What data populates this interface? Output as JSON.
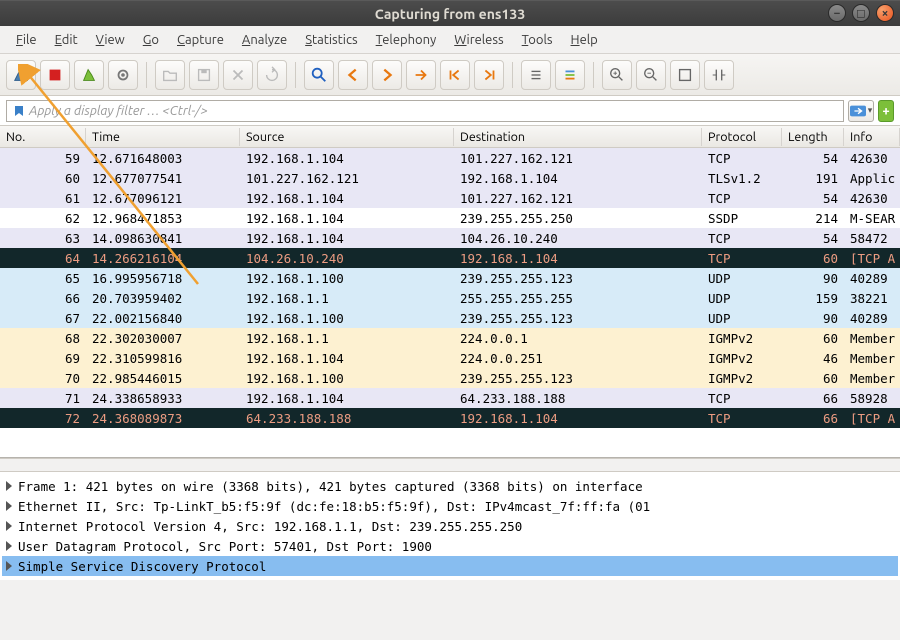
{
  "window": {
    "title": "Capturing from ens133"
  },
  "menubar": {
    "items": [
      "File",
      "Edit",
      "View",
      "Go",
      "Capture",
      "Analyze",
      "Statistics",
      "Telephony",
      "Wireless",
      "Tools",
      "Help"
    ]
  },
  "filter": {
    "placeholder": "Apply a display filter … <Ctrl-/>"
  },
  "columns": {
    "no": "No.",
    "time": "Time",
    "source": "Source",
    "destination": "Destination",
    "protocol": "Protocol",
    "length": "Length",
    "info": "Info"
  },
  "packets": [
    {
      "no": "59",
      "time": "12.671648003",
      "src": "192.168.1.104",
      "dst": "101.227.162.121",
      "proto": "TCP",
      "len": "54",
      "info": "42630",
      "cls": "row-lav"
    },
    {
      "no": "60",
      "time": "12.677077541",
      "src": "101.227.162.121",
      "dst": "192.168.1.104",
      "proto": "TLSv1.2",
      "len": "191",
      "info": "Applic",
      "cls": "row-lav"
    },
    {
      "no": "61",
      "time": "12.677096121",
      "src": "192.168.1.104",
      "dst": "101.227.162.121",
      "proto": "TCP",
      "len": "54",
      "info": "42630",
      "cls": "row-lav"
    },
    {
      "no": "62",
      "time": "12.968471853",
      "src": "192.168.1.104",
      "dst": "239.255.255.250",
      "proto": "SSDP",
      "len": "214",
      "info": "M-SEAR",
      "cls": "row-white"
    },
    {
      "no": "63",
      "time": "14.098630841",
      "src": "192.168.1.104",
      "dst": "104.26.10.240",
      "proto": "TCP",
      "len": "54",
      "info": "58472",
      "cls": "row-lav"
    },
    {
      "no": "64",
      "time": "14.266216104",
      "src": "104.26.10.240",
      "dst": "192.168.1.104",
      "proto": "TCP",
      "len": "60",
      "info": "[TCP A",
      "cls": "row-black"
    },
    {
      "no": "65",
      "time": "16.995956718",
      "src": "192.168.1.100",
      "dst": "239.255.255.123",
      "proto": "UDP",
      "len": "90",
      "info": "40289",
      "cls": "row-blue"
    },
    {
      "no": "66",
      "time": "20.703959402",
      "src": "192.168.1.1",
      "dst": "255.255.255.255",
      "proto": "UDP",
      "len": "159",
      "info": "38221",
      "cls": "row-blue"
    },
    {
      "no": "67",
      "time": "22.002156840",
      "src": "192.168.1.100",
      "dst": "239.255.255.123",
      "proto": "UDP",
      "len": "90",
      "info": "40289",
      "cls": "row-blue"
    },
    {
      "no": "68",
      "time": "22.302030007",
      "src": "192.168.1.1",
      "dst": "224.0.0.1",
      "proto": "IGMPv2",
      "len": "60",
      "info": "Member",
      "cls": "row-yellow"
    },
    {
      "no": "69",
      "time": "22.310599816",
      "src": "192.168.1.104",
      "dst": "224.0.0.251",
      "proto": "IGMPv2",
      "len": "46",
      "info": "Member",
      "cls": "row-yellow"
    },
    {
      "no": "70",
      "time": "22.985446015",
      "src": "192.168.1.100",
      "dst": "239.255.255.123",
      "proto": "IGMPv2",
      "len": "60",
      "info": "Member",
      "cls": "row-yellow"
    },
    {
      "no": "71",
      "time": "24.338658933",
      "src": "192.168.1.104",
      "dst": "64.233.188.188",
      "proto": "TCP",
      "len": "66",
      "info": "58928",
      "cls": "row-lav"
    },
    {
      "no": "72",
      "time": "24.368089873",
      "src": "64.233.188.188",
      "dst": "192.168.1.104",
      "proto": "TCP",
      "len": "66",
      "info": "[TCP A",
      "cls": "row-black"
    }
  ],
  "details": [
    "Frame 1: 421 bytes on wire (3368 bits), 421 bytes captured (3368 bits) on interface",
    "Ethernet II, Src: Tp-LinkT_b5:f5:9f (dc:fe:18:b5:f5:9f), Dst: IPv4mcast_7f:ff:fa (01",
    "Internet Protocol Version 4, Src: 192.168.1.1, Dst: 239.255.255.250",
    "User Datagram Protocol, Src Port: 57401, Dst Port: 1900",
    "Simple Service Discovery Protocol"
  ]
}
